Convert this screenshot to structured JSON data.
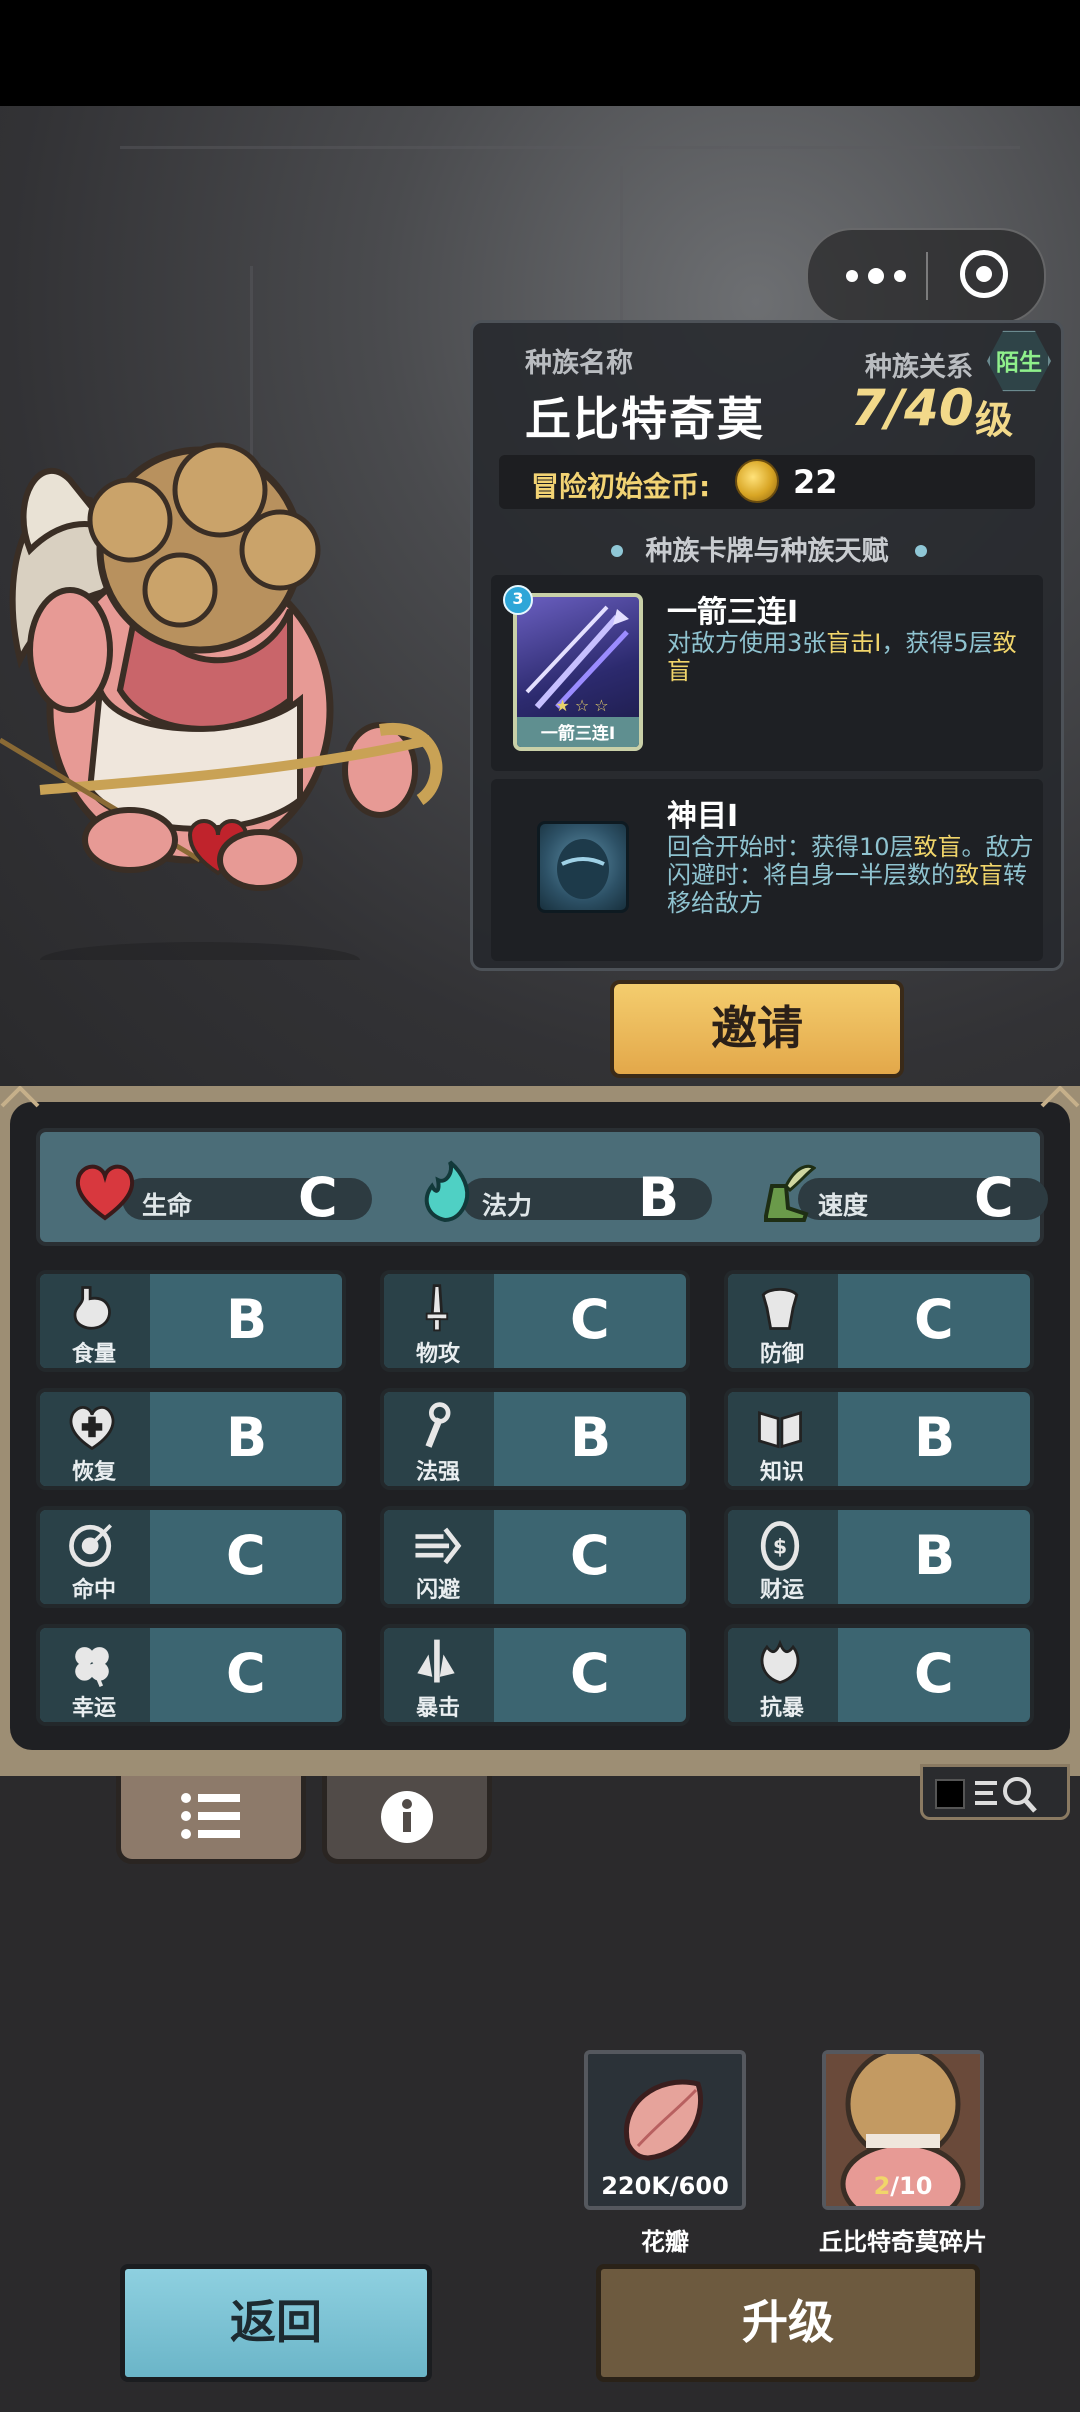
{
  "colors": {
    "accent_gold": "#f2d98a",
    "stat_cell": "#3c6571",
    "relation_green": "#8ff08b"
  },
  "race": {
    "name_label": "种族名称",
    "name": "丘比特奇莫",
    "relation_label": "种族关系",
    "relation": "陌生",
    "level": "7/40",
    "level_unit": "级",
    "gold_label": "冒险初始金币:",
    "gold_value": "22",
    "section_title": "种族卡牌与种族天赋"
  },
  "card": {
    "cost": "3",
    "art_name": "一箭三连I",
    "title": "一箭三连I",
    "desc_pre": "对敌方使用3张",
    "desc_hl1": "盲击I",
    "desc_mid": "，获得5层",
    "desc_hl2": "致盲"
  },
  "talent": {
    "title": "神目I",
    "desc_a": "回合开始时：获得10层",
    "desc_hl1": "致盲",
    "desc_b": "。敌方闪避时：将自身一半层数的",
    "desc_hl2": "致盲",
    "desc_c": "转移给敌方"
  },
  "invite_label": "邀请",
  "top_stats": [
    {
      "name": "生命",
      "grade": "C",
      "icon": "heart-icon"
    },
    {
      "name": "法力",
      "grade": "B",
      "icon": "flame-icon"
    },
    {
      "name": "速度",
      "grade": "C",
      "icon": "wing-boot-icon"
    }
  ],
  "stats": [
    {
      "name": "食量",
      "grade": "B",
      "icon": "stomach-icon"
    },
    {
      "name": "物攻",
      "grade": "C",
      "icon": "sword-icon"
    },
    {
      "name": "防御",
      "grade": "C",
      "icon": "armor-icon"
    },
    {
      "name": "恢复",
      "grade": "B",
      "icon": "heart-plus-icon"
    },
    {
      "name": "法强",
      "grade": "B",
      "icon": "staff-icon"
    },
    {
      "name": "知识",
      "grade": "B",
      "icon": "book-icon"
    },
    {
      "name": "命中",
      "grade": "C",
      "icon": "target-icon"
    },
    {
      "name": "闪避",
      "grade": "C",
      "icon": "dash-icon"
    },
    {
      "name": "财运",
      "grade": "B",
      "icon": "coin-icon"
    },
    {
      "name": "幸运",
      "grade": "C",
      "icon": "clover-icon"
    },
    {
      "name": "暴击",
      "grade": "C",
      "icon": "crit-icon"
    },
    {
      "name": "抗暴",
      "grade": "C",
      "icon": "shell-icon"
    }
  ],
  "materials": [
    {
      "name": "花瓣",
      "count": "220K/600",
      "icon": "petal-icon"
    },
    {
      "name": "丘比特奇莫碎片",
      "count_have": "2",
      "count_need": "/10",
      "icon": "cupid-portrait"
    }
  ],
  "buttons": {
    "back": "返回",
    "upgrade": "升级"
  }
}
